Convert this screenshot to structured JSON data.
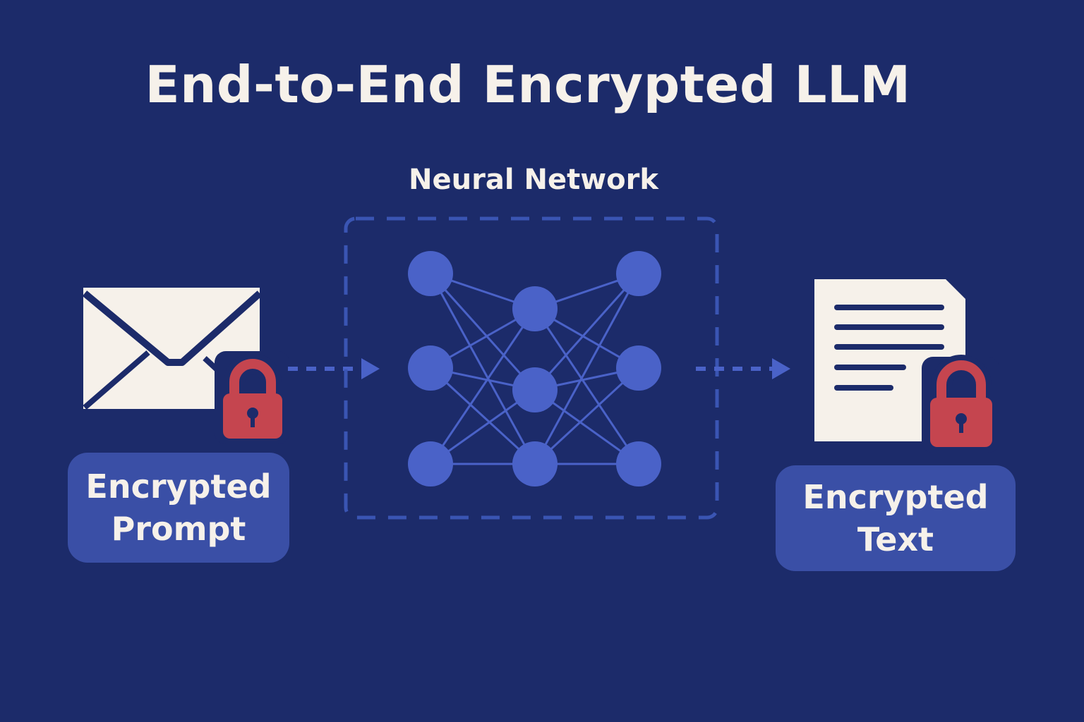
{
  "title": "End-to-End Encrypted LLM",
  "network": {
    "label": "Neural Network"
  },
  "input": {
    "line1": "Encrypted",
    "line2": "Prompt",
    "icon": "envelope-icon"
  },
  "output": {
    "line1": "Encrypted",
    "line2": "Text",
    "icon": "document-icon"
  },
  "colors": {
    "background": "#1c2b6a",
    "accent": "#4a62c8",
    "box": "#3a4fa6",
    "lock": "#c5454f",
    "paper": "#f6f1ea"
  }
}
